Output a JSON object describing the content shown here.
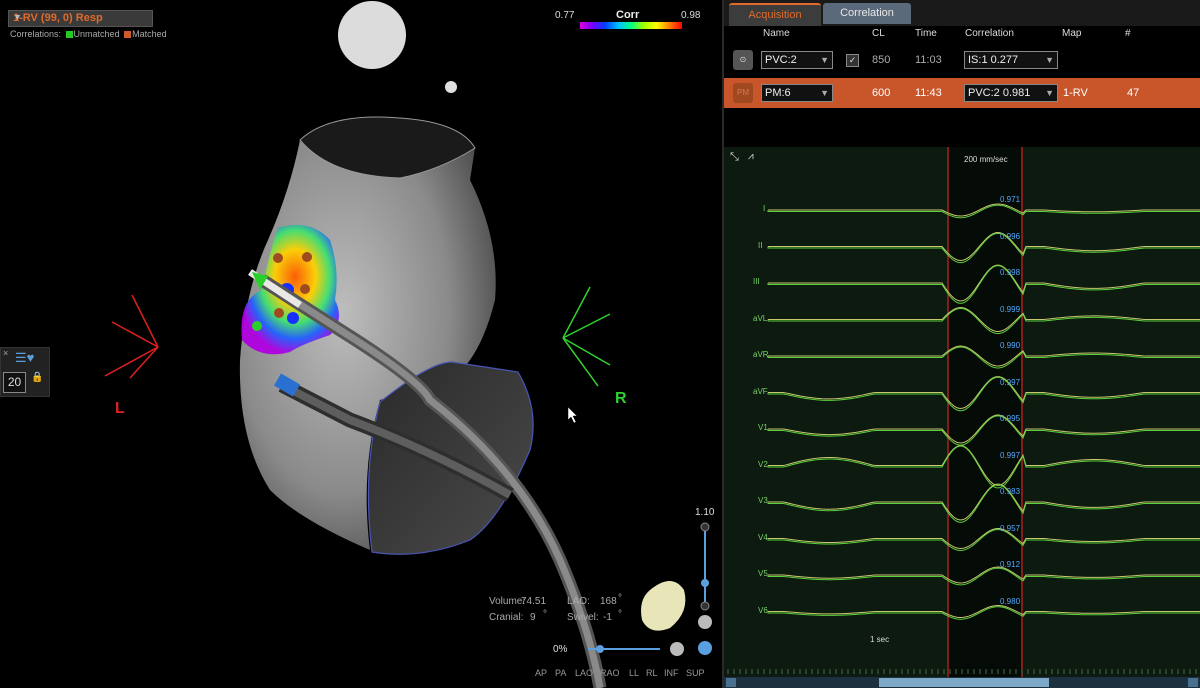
{
  "map_panel": {
    "map_selector": "1-RV (99, 0) Resp",
    "correlations_label": "Correlations:",
    "legend_unmatched": "Unmatched",
    "legend_matched": "Matched",
    "colors": {
      "unmatched": "#22cc22",
      "matched": "#cc5a2a"
    }
  },
  "scale": {
    "title": "Corr",
    "min": "0.77",
    "max": "0.98"
  },
  "orientation": {
    "left": "L",
    "right": "R"
  },
  "side_panel": {
    "count": "20"
  },
  "zoom": {
    "value": "1.10",
    "transparency": "0%"
  },
  "info": {
    "volume_label": "Volume:",
    "volume_value": "74.51",
    "lao_label": "LAO:",
    "lao_value": "168",
    "cranial_label": "Cranial:",
    "cranial_value": "9",
    "swivel_label": "Swivel:",
    "swivel_value": "-1",
    "degree": "°"
  },
  "views": [
    "AP",
    "PA",
    "LAO",
    "RAO",
    "LL",
    "RL",
    "INF",
    "SUP"
  ],
  "tabs": [
    "Acquisition",
    "Correlation"
  ],
  "table": {
    "headers": [
      "Name",
      "CL",
      "Time",
      "Correlation",
      "Map",
      "#"
    ],
    "rows": [
      {
        "icon": "⊙",
        "name": "PVC:2",
        "checked": true,
        "cl": "850",
        "time": "11:03",
        "correlation": "IS:1  0.277",
        "map": "",
        "count": ""
      },
      {
        "icon": "PM",
        "name": "PM:6",
        "checked": false,
        "cl": "600",
        "time": "11:43",
        "correlation": "PVC:2  0.981",
        "map": "1-RV",
        "count": "47"
      }
    ]
  },
  "ecg": {
    "speed": "200 mm/sec",
    "time_scale": "1 sec",
    "leads": [
      {
        "name": "I",
        "corr": "0.971"
      },
      {
        "name": "II",
        "corr": "0.996"
      },
      {
        "name": "III",
        "corr": "0.998"
      },
      {
        "name": "aVL",
        "corr": "0.999"
      },
      {
        "name": "aVR",
        "corr": "0.990"
      },
      {
        "name": "aVF",
        "corr": "0.997"
      },
      {
        "name": "V1",
        "corr": "0.995"
      },
      {
        "name": "V2",
        "corr": "0.997"
      },
      {
        "name": "V3",
        "corr": "0.983"
      },
      {
        "name": "V4",
        "corr": "0.957"
      },
      {
        "name": "V5",
        "corr": "0.912"
      },
      {
        "name": "V6",
        "corr": "0.980"
      }
    ]
  }
}
